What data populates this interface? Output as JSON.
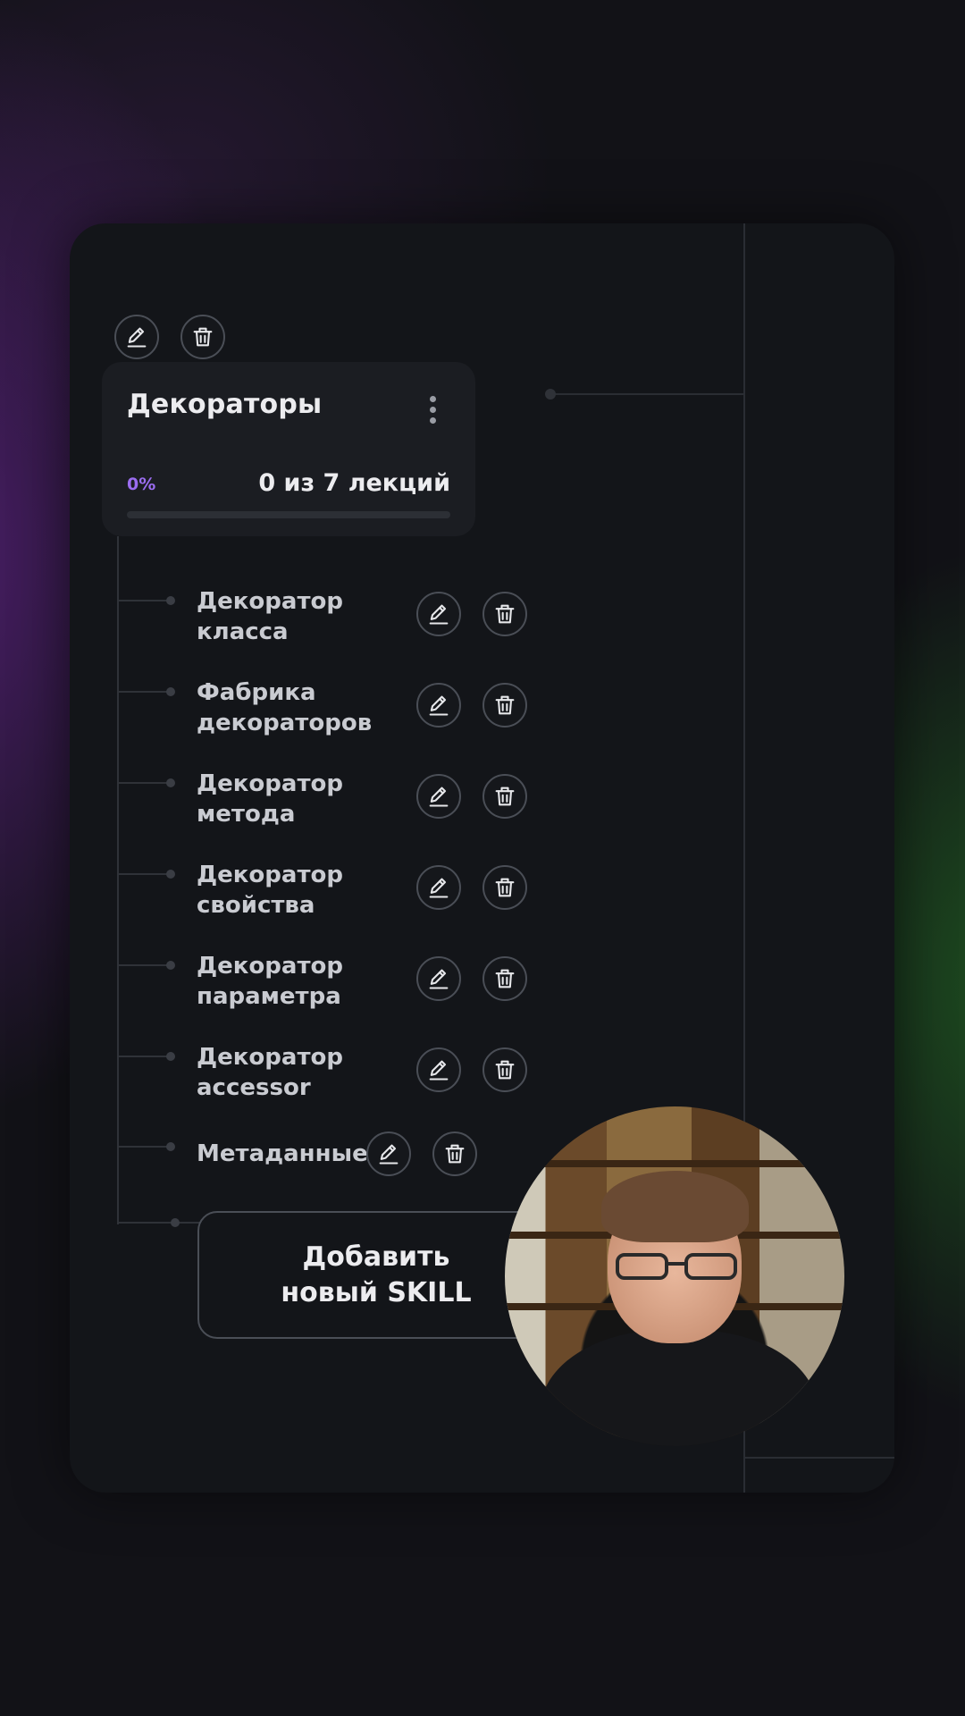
{
  "module": {
    "title": "Декораторы",
    "progress_label": "0%",
    "progress_value": 0,
    "lessons_count": "0 из 7 лекций"
  },
  "lessons": [
    {
      "label": "Декоратор класса"
    },
    {
      "label": "Фабрика декораторов"
    },
    {
      "label": "Декоратор метода"
    },
    {
      "label": "Декоратор свойства"
    },
    {
      "label": "Декоратор параметра"
    },
    {
      "label": "Декоратор accessor"
    },
    {
      "label": "Метаданные"
    }
  ],
  "add_button": {
    "label_line1": "Добавить",
    "label_line2": "новый SKILL"
  },
  "icons": {
    "edit": "pencil-icon",
    "delete": "trash-icon",
    "menu": "more-vertical-icon"
  },
  "colors": {
    "accent": "#9b6df0",
    "panel": "#131519",
    "card": "#1b1d22"
  }
}
